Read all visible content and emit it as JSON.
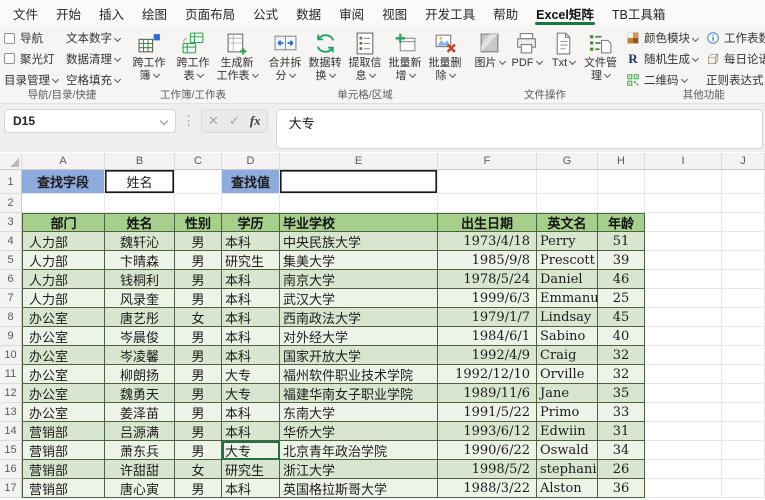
{
  "window": {
    "active_tab": "Excel矩阵"
  },
  "menu_tabs": [
    {
      "id": "file",
      "label": "文件"
    },
    {
      "id": "home",
      "label": "开始"
    },
    {
      "id": "insert",
      "label": "插入"
    },
    {
      "id": "draw",
      "label": "绘图"
    },
    {
      "id": "page-layout",
      "label": "页面布局"
    },
    {
      "id": "formulas",
      "label": "公式"
    },
    {
      "id": "data",
      "label": "数据"
    },
    {
      "id": "review",
      "label": "审阅"
    },
    {
      "id": "view",
      "label": "视图"
    },
    {
      "id": "developer",
      "label": "开发工具"
    },
    {
      "id": "help",
      "label": "帮助"
    },
    {
      "id": "excel-matrix",
      "label": "Excel矩阵"
    },
    {
      "id": "tb-toolbox",
      "label": "TB工具箱"
    }
  ],
  "ribbon": {
    "groups": [
      {
        "name": "导航/目录/快捷",
        "layout": "stack",
        "items": [
          {
            "id": "nav",
            "label": "导航",
            "checkbox": true,
            "dropdown": false
          },
          {
            "id": "spotlight",
            "label": "聚光灯",
            "checkbox": true,
            "dropdown": false
          },
          {
            "id": "toc-manage",
            "label": "目录管理",
            "checkbox": false,
            "dropdown": true
          },
          {
            "id": "text-number",
            "label": "文本数字",
            "checkbox": false,
            "dropdown": true
          },
          {
            "id": "data-clean",
            "label": "数据清理",
            "checkbox": false,
            "dropdown": true
          },
          {
            "id": "space-fill",
            "label": "空格填充",
            "checkbox": false,
            "dropdown": true
          }
        ]
      },
      {
        "name": "工作簿/工作表",
        "layout": "big",
        "btnw": 42,
        "items": [
          {
            "id": "cross-workbook",
            "label": "跨工作簿",
            "icon": "workbook-cube",
            "dropdown": true
          },
          {
            "id": "cross-sheet",
            "label": "跨工作表",
            "icon": "sheets",
            "dropdown": true
          },
          {
            "id": "new-sheet",
            "label": "生成新工作表",
            "icon": "new-sheet",
            "dropdown": true
          }
        ]
      },
      {
        "name": "单元格/区域",
        "layout": "big",
        "btnw": 38,
        "items": [
          {
            "id": "merge-split",
            "label": "合并拆分",
            "icon": "merge-split",
            "dropdown": true
          },
          {
            "id": "convert",
            "label": "数据转换",
            "icon": "convert",
            "dropdown": true
          },
          {
            "id": "extract",
            "label": "提取信息",
            "icon": "extract",
            "dropdown": true
          },
          {
            "id": "batch-add",
            "label": "批量新增",
            "icon": "batch-add",
            "dropdown": true
          },
          {
            "id": "batch-delete",
            "label": "批量删除",
            "icon": "batch-delete",
            "dropdown": true
          }
        ]
      },
      {
        "name": "文件操作",
        "layout": "big",
        "btnw": 35,
        "items": [
          {
            "id": "picture",
            "label": "图片",
            "icon": "picture",
            "dropdown": true
          },
          {
            "id": "pdf",
            "label": "PDF",
            "icon": "pdf",
            "dropdown": true
          },
          {
            "id": "txt",
            "label": "Txt",
            "icon": "txt",
            "dropdown": true
          },
          {
            "id": "file-manage",
            "label": "文件管理",
            "icon": "file-manage",
            "dropdown": true
          }
        ]
      },
      {
        "name": "其他功能",
        "layout": "stack",
        "items": [
          {
            "id": "color-module",
            "label": "颜色模块",
            "icon": "color-module",
            "dropdown": true
          },
          {
            "id": "random",
            "label": "随机生成",
            "icon": "random-r",
            "dropdown": true
          },
          {
            "id": "qrcode",
            "label": "二维码",
            "icon": "qrcode",
            "dropdown": true
          },
          {
            "id": "sheet-count",
            "label": "工作表数量",
            "icon": "info",
            "dropdown": false
          },
          {
            "id": "daily",
            "label": "每日论语",
            "icon": "daily-cube",
            "dropdown": false
          },
          {
            "id": "regex",
            "label": "正则表达式",
            "icon": null,
            "dropdown": false
          }
        ]
      }
    ]
  },
  "formula_bar": {
    "name_box": "D15",
    "cancel": "✕",
    "confirm": "✓",
    "fx": "fx",
    "content": "大专"
  },
  "grid": {
    "column_headers": [
      "A",
      "B",
      "C",
      "D",
      "E",
      "F",
      "G",
      "H",
      "I",
      "J"
    ],
    "row_count": 17,
    "selected_cell": "D15",
    "find_row": {
      "field_label": "查找字段",
      "field_value": "姓名",
      "value_label": "查找值",
      "value_input": ""
    }
  },
  "table": {
    "headers": [
      "部门",
      "姓名",
      "性别",
      "学历",
      "毕业学校",
      "出生日期",
      "英文名",
      "年龄"
    ],
    "rows": [
      [
        "人力部",
        "魏轩沁",
        "男",
        "本科",
        "中央民族大学",
        "1973/4/18",
        "Perry",
        "51"
      ],
      [
        "人力部",
        "卞晴森",
        "男",
        "研究生",
        "集美大学",
        "1985/9/8",
        "Prescott",
        "39"
      ],
      [
        "人力部",
        "钱桐利",
        "男",
        "本科",
        "南京大学",
        "1978/5/24",
        "Daniel",
        "46"
      ],
      [
        "人力部",
        "风录奎",
        "男",
        "本科",
        "武汉大学",
        "1999/6/3",
        "Emmanuel",
        "25"
      ],
      [
        "办公室",
        "唐艺彤",
        "女",
        "本科",
        "西南政法大学",
        "1979/1/7",
        "Lindsay",
        "45"
      ],
      [
        "办公室",
        "岑晨俊",
        "男",
        "本科",
        "对外经大学",
        "1984/6/1",
        "Sabino",
        "40"
      ],
      [
        "办公室",
        "岑凌馨",
        "男",
        "本科",
        "国家开放大学",
        "1992/4/9",
        "Craig",
        "32"
      ],
      [
        "办公室",
        "柳朗扬",
        "男",
        "大专",
        "福州软件职业技术学院",
        "1992/12/10",
        "Orville",
        "32"
      ],
      [
        "办公室",
        "魏勇天",
        "男",
        "大专",
        "福建华南女子职业学院",
        "1989/11/6",
        "Jane",
        "35"
      ],
      [
        "办公室",
        "姜泽苗",
        "男",
        "本科",
        "东南大学",
        "1991/5/22",
        "Primo",
        "33"
      ],
      [
        "营销部",
        "吕源满",
        "男",
        "本科",
        "华侨大学",
        "1993/6/12",
        "Edwiin",
        "31"
      ],
      [
        "营销部",
        "萧东兵",
        "男",
        "大专",
        "北京青年政治学院",
        "1990/6/22",
        "Oswald",
        "34"
      ],
      [
        "营销部",
        "许甜甜",
        "女",
        "研究生",
        "浙江大学",
        "1998/5/2",
        "stephanie",
        "26"
      ],
      [
        "营销部",
        "唐心寅",
        "男",
        "本科",
        "英国格拉斯哥大学",
        "1988/3/22",
        "Alston",
        "36"
      ]
    ]
  },
  "colors": {
    "accent": "#15783c",
    "find_fill": "#8faadc",
    "thead_fill": "#a6cf8b",
    "band_even": "#d8e6cf",
    "band_odd": "#edf4e7",
    "t_border": "#4c6342"
  }
}
